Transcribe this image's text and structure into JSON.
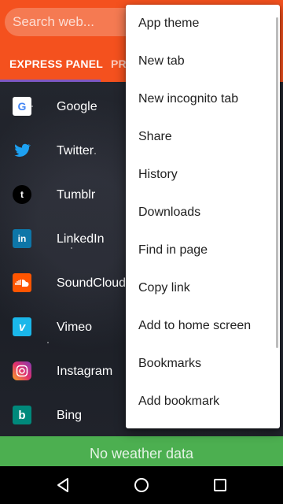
{
  "search": {
    "placeholder": "Search web..."
  },
  "tabs": [
    {
      "label": "EXPRESS PANEL"
    },
    {
      "label": "PR"
    }
  ],
  "sites": [
    {
      "label": "Google",
      "icon": "google-icon",
      "color": "#ffffff",
      "glyph": "G",
      "glyph_color": "#4285f4"
    },
    {
      "label": "Twitter",
      "icon": "twitter-icon",
      "color": "transparent",
      "glyph": "",
      "glyph_color": "#1da1f2"
    },
    {
      "label": "Tumblr",
      "icon": "tumblr-icon",
      "color": "#000000",
      "glyph": "t",
      "glyph_color": "#ffffff"
    },
    {
      "label": "LinkedIn",
      "icon": "linkedin-icon",
      "color": "#0e76a8",
      "glyph": "in",
      "glyph_color": "#ffffff"
    },
    {
      "label": "SoundCloud",
      "icon": "soundcloud-icon",
      "color": "#ff5500",
      "glyph": "",
      "glyph_color": "#ffffff"
    },
    {
      "label": "Vimeo",
      "icon": "vimeo-icon",
      "color": "#1ab7ea",
      "glyph": "v",
      "glyph_color": "#ffffff"
    },
    {
      "label": "Instagram",
      "icon": "instagram-icon",
      "color": "#c13584",
      "glyph": "",
      "glyph_color": "#ffffff"
    },
    {
      "label": "Bing",
      "icon": "bing-icon",
      "color": "#00897b",
      "glyph": "b",
      "glyph_color": "#ffffff"
    }
  ],
  "menu": {
    "items": [
      "App theme",
      "New tab",
      "New incognito tab",
      "Share",
      "History",
      "Downloads",
      "Find in page",
      "Copy link",
      "Add to home screen",
      "Bookmarks",
      "Add bookmark"
    ]
  },
  "weather": {
    "text": "No weather data"
  },
  "colors": {
    "accent": "#f4511e",
    "indicator": "#7e57c2",
    "weather_bar": "#4caf50"
  }
}
